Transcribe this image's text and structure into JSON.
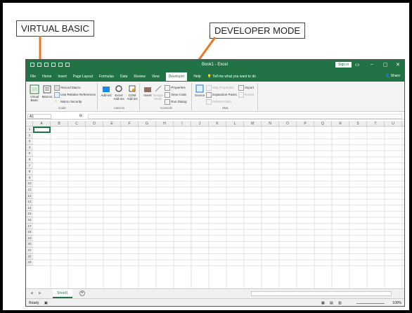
{
  "callouts": {
    "virtual_basic": "VIRTUAL BASIC",
    "developer_mode": "DEVELOPER MODE"
  },
  "window": {
    "title": "Book1 - Excel",
    "sign_in": "Sign in",
    "minimize": "–",
    "restore": "▢",
    "close": "✕"
  },
  "tabs": [
    {
      "label": "File"
    },
    {
      "label": "Home"
    },
    {
      "label": "Insert"
    },
    {
      "label": "Page Layout"
    },
    {
      "label": "Formulas"
    },
    {
      "label": "Data"
    },
    {
      "label": "Review"
    },
    {
      "label": "View"
    },
    {
      "label": "Developer",
      "active": true
    },
    {
      "label": "Help"
    },
    {
      "label": "Tell me what you want to do"
    }
  ],
  "share_label": "Share",
  "ribbon": {
    "code": {
      "label": "Code",
      "visual_basic": "Visual Basic",
      "macros": "Macros",
      "record_macro": "Record Macro",
      "relative_refs": "Use Relative References",
      "macro_security": "Macro Security"
    },
    "addins": {
      "label": "Add-ins",
      "add_ins": "Add-ins",
      "excel_addins": "Excel Add-ins",
      "com_addins": "COM Add-ins"
    },
    "controls": {
      "label": "Controls",
      "insert": "Insert",
      "design_mode": "Design Mode",
      "properties": "Properties",
      "view_code": "View Code",
      "run_dialog": "Run Dialog"
    },
    "xml": {
      "label": "XML",
      "source": "Source",
      "map_properties": "Map Properties",
      "expansion_packs": "Expansion Packs",
      "refresh_data": "Refresh Data",
      "import": "Import",
      "export": "Export"
    }
  },
  "formula_bar": {
    "name_box": "A1",
    "fx": "fx",
    "value": ""
  },
  "columns": [
    "A",
    "B",
    "C",
    "D",
    "E",
    "F",
    "G",
    "H",
    "I",
    "J",
    "K",
    "L",
    "M",
    "N",
    "O",
    "P",
    "Q",
    "R",
    "S",
    "T",
    "U"
  ],
  "rows": [
    "1",
    "2",
    "3",
    "4",
    "5",
    "6",
    "7",
    "8",
    "9",
    "10",
    "11",
    "12",
    "13",
    "14",
    "15",
    "16",
    "17",
    "18",
    "19",
    "20",
    "21",
    "22",
    "23"
  ],
  "sheet_tab": "Sheet1",
  "add_sheet": "+",
  "status": {
    "ready": "Ready",
    "zoom": "100%"
  },
  "colors": {
    "excel_green": "#217346"
  }
}
